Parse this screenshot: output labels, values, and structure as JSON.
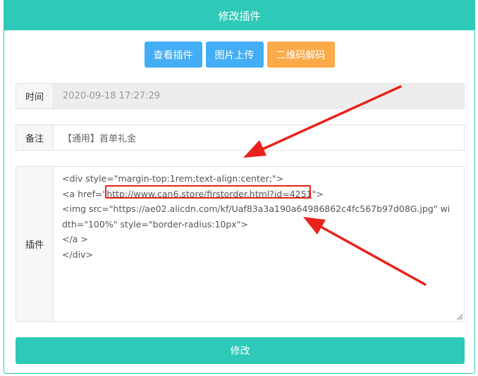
{
  "header": {
    "title": "修改插件"
  },
  "toolbar": {
    "view_plugin": "查看插件",
    "upload_image": "图片上传",
    "qr_decode": "二维码解码"
  },
  "fields": {
    "time": {
      "label": "时间",
      "value": "2020-09-18 17:27:29"
    },
    "note": {
      "label": "备注",
      "value": "【通用】首单礼金"
    },
    "plugin": {
      "label": "插件",
      "lines": {
        "l1": "<div style=\"margin-top:1rem;text-align:center;\">",
        "l2_pre": "<a href=\"",
        "l2_link": "http://www.can6.store/firstorder.html?id=4251",
        "l2_post": "\">",
        "l3": "<img src=\"https://ae02.alicdn.com/kf/Uaf83a3a190a64986862c4fc567b97d08G.jpg\" width=\"100%\" style=\"border-radius:10px\">",
        "l4": "</a >",
        "l5": "</div>"
      }
    }
  },
  "submit": {
    "label": "修改"
  },
  "colors": {
    "teal": "#2ec9b8",
    "blue": "#43aef6",
    "orange": "#fbaa4a",
    "annotation_red": "#e8221b"
  }
}
